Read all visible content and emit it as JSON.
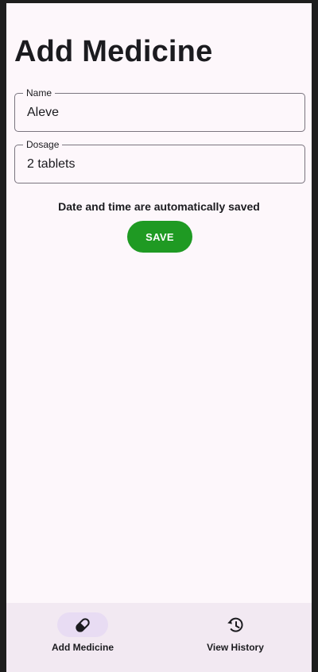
{
  "page": {
    "title": "Add Medicine"
  },
  "form": {
    "name": {
      "label": "Name",
      "value": "Aleve"
    },
    "dosage": {
      "label": "Dosage",
      "value": "2 tablets"
    },
    "info_text": "Date and time are automatically saved",
    "save_label": "SAVE"
  },
  "bottom_nav": {
    "items": [
      {
        "label": "Add Medicine",
        "icon": "pill-icon",
        "selected": true
      },
      {
        "label": "View History",
        "icon": "history-icon",
        "selected": false
      }
    ]
  },
  "colors": {
    "background": "#fdf7fb",
    "accent": "#1f9a23",
    "nav_background": "#f2e9f2",
    "nav_indicator": "#e8dcf3"
  }
}
